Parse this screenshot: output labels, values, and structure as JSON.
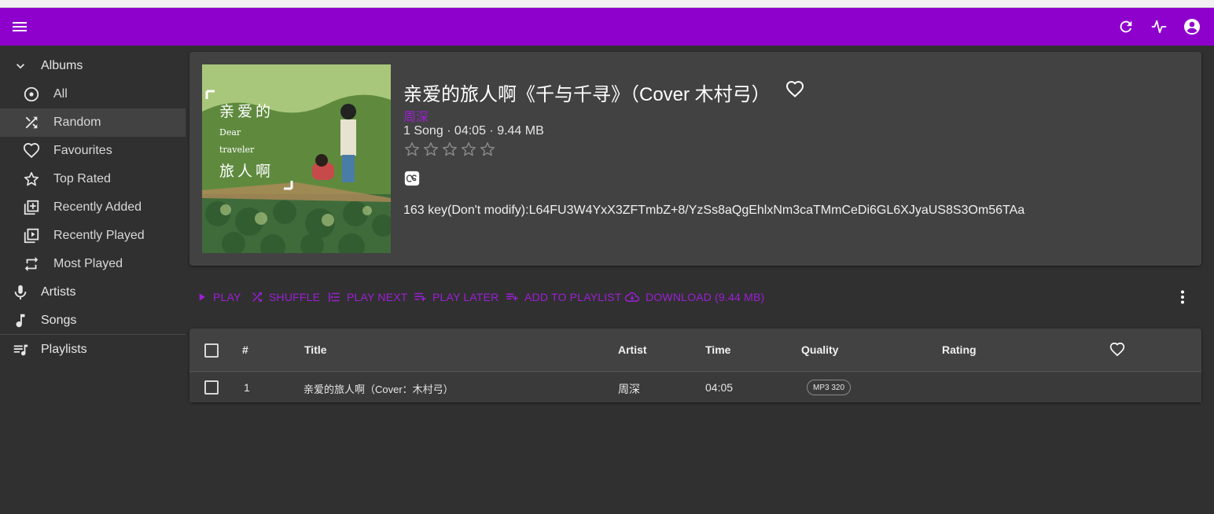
{
  "app": {
    "accent_color": "#8e00cc",
    "link_color": "#9c1fd6"
  },
  "appbar": {
    "icons": [
      "menu-icon",
      "refresh-icon",
      "activity-icon",
      "account-icon"
    ]
  },
  "sidebar": {
    "albums_label": "Albums",
    "items": [
      {
        "label": "All",
        "icon": "album-icon"
      },
      {
        "label": "Random",
        "icon": "shuffle-icon",
        "selected": true
      },
      {
        "label": "Favourites",
        "icon": "heart-icon"
      },
      {
        "label": "Top Rated",
        "icon": "star-icon"
      },
      {
        "label": "Recently Added",
        "icon": "library-add-icon"
      },
      {
        "label": "Recently Played",
        "icon": "video-library-icon"
      },
      {
        "label": "Most Played",
        "icon": "repeat-icon"
      }
    ],
    "artists_label": "Artists",
    "songs_label": "Songs",
    "playlists_label": "Playlists"
  },
  "album": {
    "title": "亲爱的旅人啊《千与千寻》（Cover 木村弓）",
    "artist": "周深",
    "meta": "1 Song · 04:05 · 9.44 MB",
    "rating": 0,
    "rating_max": 5,
    "comment": "163 key(Don't modify):L64FU3W4YxX3ZFTmbZ+8/YzSs8aQgEhlxNm3caTMmCeDi6GL6XJyaUS8S3Om56TAa",
    "cover_text": {
      "line1": "亲爱的",
      "line2": "Dear",
      "line3": "traveler",
      "line4": "旅人啊"
    }
  },
  "actions": {
    "play": "PLAY",
    "shuffle": "SHUFFLE",
    "play_next": "PLAY NEXT",
    "play_later": "PLAY LATER",
    "add_to_playlist": "ADD TO PLAYLIST",
    "download": "DOWNLOAD (9.44 MB)"
  },
  "table": {
    "headers": {
      "number": "#",
      "title": "Title",
      "artist": "Artist",
      "time": "Time",
      "quality": "Quality",
      "rating": "Rating"
    },
    "rows": [
      {
        "number": "1",
        "title": "亲爱的旅人啊（Cover：木村弓）",
        "artist": "周深",
        "time": "04:05",
        "quality": "MP3 320"
      }
    ]
  }
}
